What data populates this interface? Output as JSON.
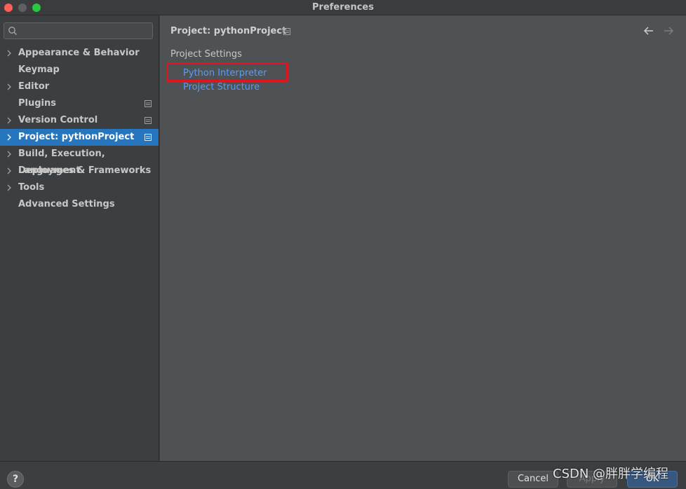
{
  "window": {
    "title": "Preferences"
  },
  "search": {
    "placeholder": "",
    "value": ""
  },
  "sidebar": {
    "items": [
      {
        "label": "Appearance & Behavior",
        "expandable": true
      },
      {
        "label": "Keymap",
        "expandable": false
      },
      {
        "label": "Editor",
        "expandable": true
      },
      {
        "label": "Plugins",
        "expandable": false,
        "badge": true
      },
      {
        "label": "Version Control",
        "expandable": true,
        "badge": true
      },
      {
        "label": "Project: pythonProject",
        "expandable": true,
        "badge": true,
        "selected": true
      },
      {
        "label": "Build, Execution, Deployment",
        "expandable": true
      },
      {
        "label": "Languages & Frameworks",
        "expandable": true
      },
      {
        "label": "Tools",
        "expandable": true
      },
      {
        "label": "Advanced Settings",
        "expandable": false
      }
    ]
  },
  "main": {
    "breadcrumb": "Project: pythonProject",
    "section_title": "Project Settings",
    "links": [
      {
        "label": "Python Interpreter",
        "highlighted": true
      },
      {
        "label": "Project Structure"
      }
    ]
  },
  "footer": {
    "help_label": "?",
    "cancel_label": "Cancel",
    "apply_label": "Apply",
    "ok_label": "OK"
  },
  "watermark": "CSDN @胖胖学编程",
  "colors": {
    "accent": "#2675bf",
    "link": "#589df6",
    "highlight_box": "#e0161f",
    "background": "#4e5254",
    "sidebar_background": "#3c3f41"
  },
  "icons": {
    "search": "search-icon",
    "chevron": "chevron-right-icon",
    "badge": "project-level-icon",
    "back": "arrow-left-icon",
    "forward": "arrow-right-icon",
    "help": "help-icon"
  }
}
